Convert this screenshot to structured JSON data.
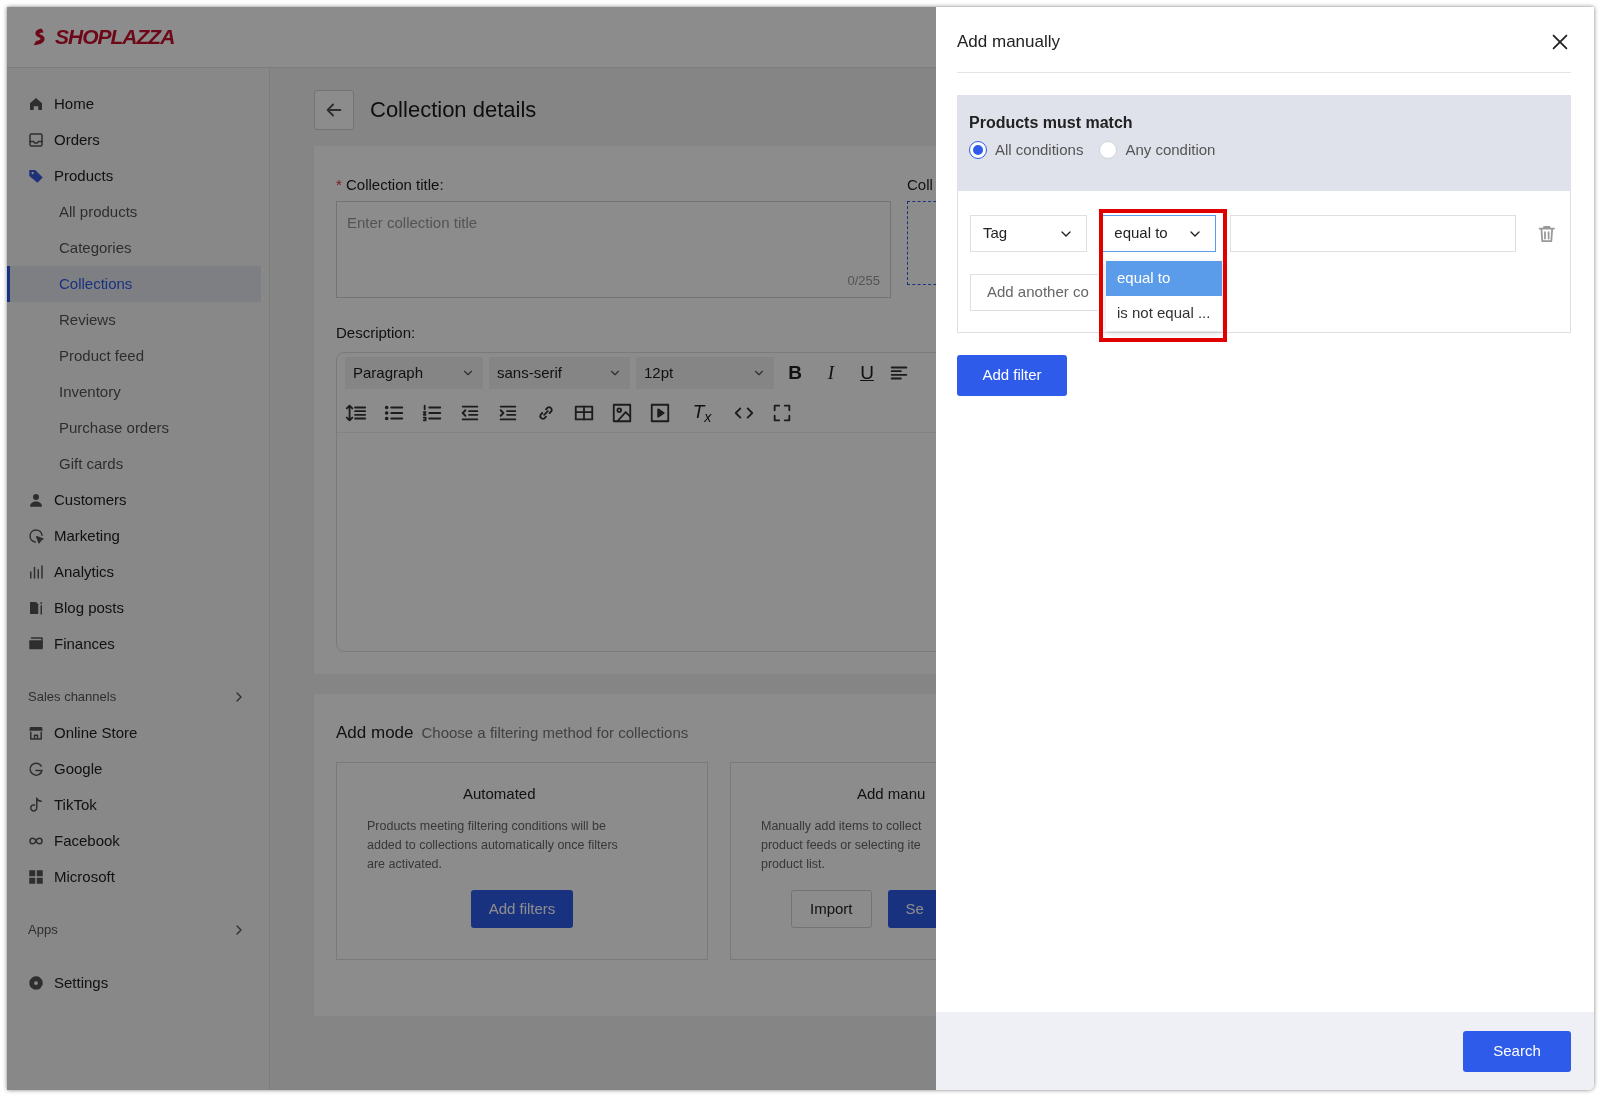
{
  "logo": {
    "text": "SHOPLAZZA"
  },
  "sidebar": {
    "sections": [
      {
        "items": [
          {
            "label": "Home",
            "selected": false
          },
          {
            "label": "Orders",
            "selected": false
          },
          {
            "label": "Products",
            "selected": false,
            "expanded": true,
            "children": [
              {
                "label": "All products",
                "selected": false
              },
              {
                "label": "Categories",
                "selected": false
              },
              {
                "label": "Collections",
                "selected": true
              },
              {
                "label": "Reviews",
                "selected": false
              },
              {
                "label": "Product feed",
                "selected": false
              },
              {
                "label": "Inventory",
                "selected": false
              },
              {
                "label": "Purchase orders",
                "selected": false
              },
              {
                "label": "Gift cards",
                "selected": false
              }
            ]
          },
          {
            "label": "Customers",
            "selected": false
          },
          {
            "label": "Marketing",
            "selected": false
          },
          {
            "label": "Analytics",
            "selected": false
          },
          {
            "label": "Blog posts",
            "selected": false
          },
          {
            "label": "Finances",
            "selected": false
          }
        ]
      },
      {
        "heading": "Sales channels",
        "items": [
          {
            "label": "Online Store",
            "selected": false
          },
          {
            "label": "Google",
            "selected": false
          },
          {
            "label": "TikTok",
            "selected": false
          },
          {
            "label": "Facebook",
            "selected": false
          },
          {
            "label": "Microsoft",
            "selected": false
          }
        ]
      },
      {
        "heading": "Apps"
      },
      {
        "items": [
          {
            "label": "Settings",
            "selected": false
          }
        ]
      }
    ]
  },
  "page": {
    "title": "Collection details",
    "form": {
      "title_label": "Collection title:",
      "required_mark": "*",
      "title_placeholder": "Enter collection title",
      "char_count": "0/255",
      "side_label": "Coll",
      "description_label": "Description:",
      "editor": {
        "selects": [
          "Paragraph",
          "sans-serif",
          "12pt"
        ],
        "format_glyphs": [
          "B",
          "I",
          "U"
        ],
        "clear_format": "T$_{x}$"
      }
    },
    "add_mode": {
      "title": "Add mode",
      "subtitle": "Choose a filtering method for collections",
      "options": [
        {
          "title": "Automated",
          "description": [
            "Products meeting filtering conditions will be",
            "added to collections automatically once filters",
            "are activated."
          ],
          "buttons": [
            {
              "label": "Add filters",
              "kind": "primary"
            }
          ]
        },
        {
          "title": "Add manu",
          "description": [
            "Manually add items to collect",
            "product feeds or selecting ite",
            "product list."
          ],
          "buttons": [
            {
              "label": "Import",
              "kind": "outline"
            },
            {
              "label": "Se",
              "kind": "primary"
            }
          ]
        }
      ]
    }
  },
  "drawer": {
    "title": "Add manually",
    "match": {
      "title": "Products must match",
      "options": [
        {
          "label": "All conditions",
          "selected": true
        },
        {
          "label": "Any condition",
          "selected": false
        }
      ]
    },
    "condition": {
      "field": "Tag",
      "operator": "equal to",
      "operator_options": [
        {
          "label": "equal to",
          "selected": true
        },
        {
          "label": "is not equal ...",
          "selected": false
        }
      ],
      "highlighted": true
    },
    "add_condition": "Add another co",
    "add_filter": "Add filter",
    "search": "Search"
  }
}
